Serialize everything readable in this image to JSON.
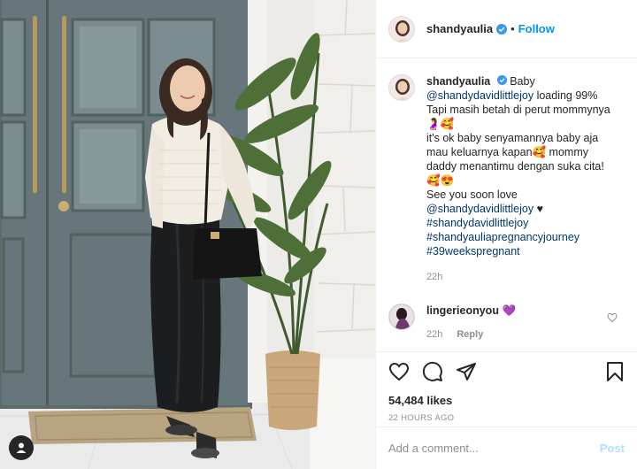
{
  "post": {
    "username": "shandyaulia",
    "follow_label": "Follow",
    "separator": "•",
    "image_alt": "Woman in white knit sweater and black satin skirt standing by a gray door with a palm plant"
  },
  "caption": {
    "username": "shandyaulia",
    "lines": [
      {
        "text": "Baby"
      },
      {
        "mention": "@shandydavidlittlejoy",
        "text": " loading 99%"
      },
      {
        "text": "Tapi masih betah di perut mommynya"
      },
      {
        "text": "🤰🥰"
      },
      {
        "text": "it's ok baby senyamannya baby aja"
      },
      {
        "text": "mau keluarnya kapan🥰 mommy"
      },
      {
        "text": "daddy menantimu dengan suka cita!"
      },
      {
        "text": "🥰😍"
      },
      {
        "text": "See you soon love"
      },
      {
        "mention": "@shandydavidlittlejoy",
        "text": " ♥"
      },
      {
        "mention": "#shandydavidlittlejoy",
        "text": ""
      },
      {
        "mention": "#shandyauliapregnancyjourney",
        "text": ""
      },
      {
        "mention": "#39weekspregnant",
        "text": ""
      }
    ],
    "time": "22h"
  },
  "comment": {
    "username": "lingerieonyou",
    "text": "💜",
    "time": "22h",
    "reply_label": "Reply"
  },
  "actions": {
    "likes": "54,484 likes",
    "ago": "22 HOURS AGO"
  },
  "add_comment": {
    "placeholder": "Add a comment...",
    "post_label": "Post"
  },
  "colors": {
    "accent": "#0095f6",
    "mention": "#00376b",
    "muted": "#8e8e8e",
    "post_disabled": "#b2dffc"
  }
}
